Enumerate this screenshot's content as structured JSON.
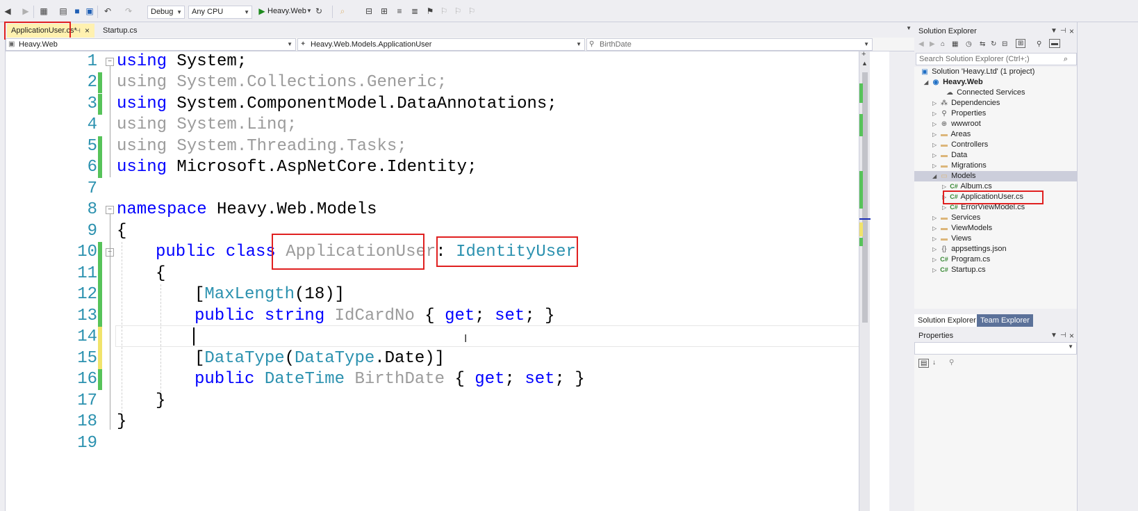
{
  "toolbar": {
    "config": "Debug",
    "platform": "Any CPU",
    "run_target": "Heavy.Web"
  },
  "tabs": {
    "active": "ApplicationUser.cs*",
    "second": "Startup.cs"
  },
  "navbar": {
    "project": "Heavy.Web",
    "class": "Heavy.Web.Models.ApplicationUser",
    "member": "BirthDate"
  },
  "code": {
    "line_numbers": [
      "1",
      "2",
      "3",
      "4",
      "5",
      "6",
      "7",
      "8",
      "9",
      "10",
      "11",
      "12",
      "13",
      "14",
      "15",
      "16",
      "17",
      "18",
      "19"
    ],
    "l1_kw": "using",
    "l1_rest": " System;",
    "l2": "using System.Collections.Generic;",
    "l3_kw": "using",
    "l3_rest": " System.ComponentModel.DataAnnotations;",
    "l4": "using System.Linq;",
    "l5": "using System.Threading.Tasks;",
    "l6_kw": "using",
    "l6_rest": " Microsoft.AspNetCore.Identity;",
    "l8_kw": "namespace",
    "l8_rest": " Heavy.Web.Models",
    "l9": "{",
    "l10_kw": "public class ",
    "l10_class": "ApplicationUser",
    "l10_colon": ": ",
    "l10_base": "IdentityUser",
    "l11": "{",
    "l12_open": "[",
    "l12_attr": "MaxLength",
    "l12_rest": "(18)]",
    "l13_kw": "public string ",
    "l13_prop": "IdCardNo",
    "l13_rest1": " { ",
    "l13_get": "get",
    "l13_mid": "; ",
    "l13_set": "set",
    "l13_end": "; }",
    "l15_open": "[",
    "l15_attr": "DataType",
    "l15_p": "(",
    "l15_type": "DataType",
    "l15_rest": ".Date)]",
    "l16_kw": "public ",
    "l16_type": "DateTime",
    "l16_prop": " BirthDate",
    "l16_rest1": " { ",
    "l16_get": "get",
    "l16_mid": "; ",
    "l16_set": "set",
    "l16_end": "; }",
    "l17": "}",
    "l18": "}"
  },
  "solution_explorer": {
    "title": "Solution Explorer",
    "search_placeholder": "Search Solution Explorer (Ctrl+;)",
    "items": [
      {
        "label": "Solution 'Heavy.Ltd' (1 project)"
      },
      {
        "label": "Heavy.Web"
      },
      {
        "label": "Connected Services"
      },
      {
        "label": "Dependencies"
      },
      {
        "label": "Properties"
      },
      {
        "label": "wwwroot"
      },
      {
        "label": "Areas"
      },
      {
        "label": "Controllers"
      },
      {
        "label": "Data"
      },
      {
        "label": "Migrations"
      },
      {
        "label": "Models"
      },
      {
        "label": "Album.cs"
      },
      {
        "label": "ApplicationUser.cs"
      },
      {
        "label": "ErrorViewModel.cs"
      },
      {
        "label": "Services"
      },
      {
        "label": "ViewModels"
      },
      {
        "label": "Views"
      },
      {
        "label": "appsettings.json"
      },
      {
        "label": "Program.cs"
      },
      {
        "label": "Startup.cs"
      }
    ],
    "tab_solution": "Solution Explorer",
    "tab_team": "Team Explorer"
  },
  "properties": {
    "title": "Properties"
  },
  "colors": {
    "keyword": "#0000ff",
    "type": "#2b91af",
    "highlight": "#e02020",
    "change_saved": "#57c35a",
    "change_unsaved": "#f1e36b"
  }
}
